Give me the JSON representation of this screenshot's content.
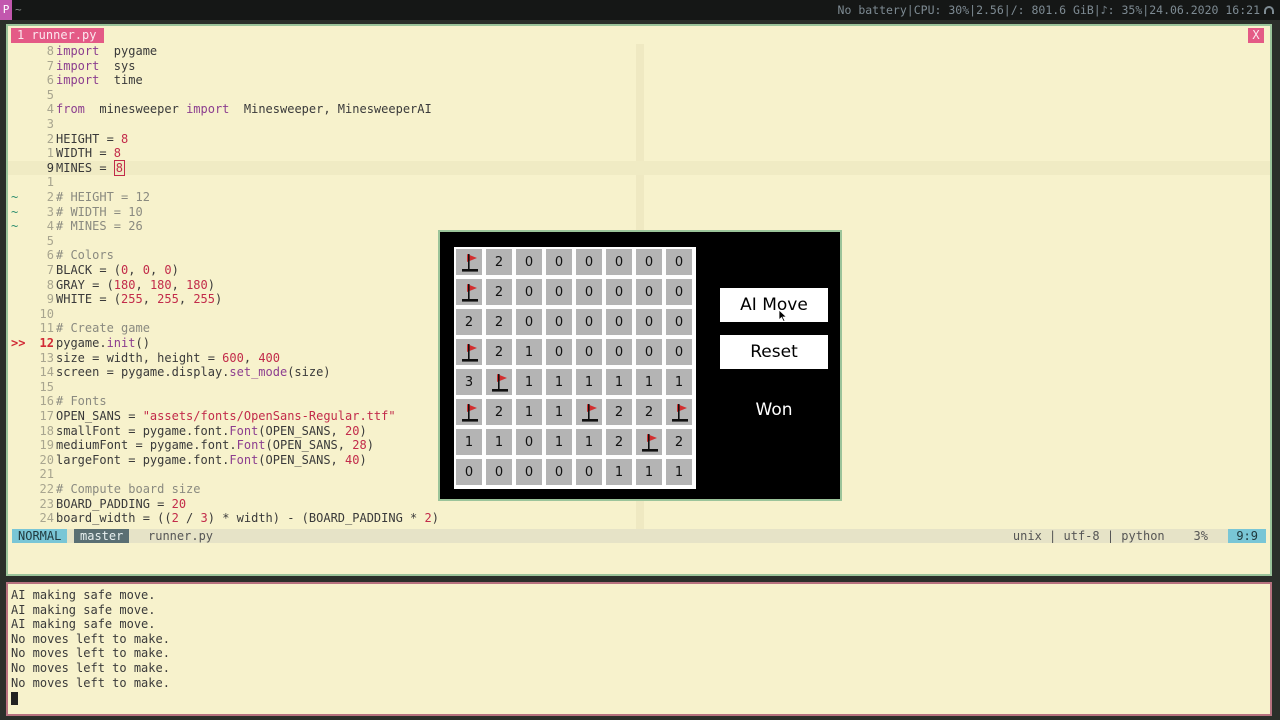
{
  "topbar": {
    "workspace": "P",
    "workspace2": "~",
    "battery": "No battery",
    "cpu": "CPU: 30%",
    "load": "2.56",
    "disk": "/: 801.6 GiB",
    "volume": "♪: 35%",
    "datetime": "24.06.2020 16:21"
  },
  "editor": {
    "tab_label": "1  runner.py",
    "tab_close": "X",
    "lines": [
      {
        "sign": "",
        "num": "8",
        "segs": [
          [
            "kw",
            "import"
          ],
          [
            "",
            "  pygame"
          ]
        ]
      },
      {
        "sign": "",
        "num": "7",
        "segs": [
          [
            "kw",
            "import"
          ],
          [
            "",
            "  sys"
          ]
        ]
      },
      {
        "sign": "",
        "num": "6",
        "segs": [
          [
            "kw",
            "import"
          ],
          [
            "",
            "  time"
          ]
        ]
      },
      {
        "sign": "",
        "num": "5",
        "segs": []
      },
      {
        "sign": "",
        "num": "4",
        "segs": [
          [
            "kw",
            "from"
          ],
          [
            "",
            "  minesweeper "
          ],
          [
            "kw",
            "import"
          ],
          [
            "",
            "  Minesweeper, MinesweeperAI"
          ]
        ]
      },
      {
        "sign": "",
        "num": "3",
        "segs": []
      },
      {
        "sign": "",
        "num": "2",
        "segs": [
          [
            "",
            "HEIGHT = "
          ],
          [
            "numl",
            "8"
          ]
        ]
      },
      {
        "sign": "",
        "num": "1",
        "segs": [
          [
            "",
            "WIDTH = "
          ],
          [
            "numl",
            "8"
          ]
        ]
      },
      {
        "sign": "",
        "num": "9",
        "cur": true,
        "segs": [
          [
            "",
            "MINES = "
          ],
          [
            "cursor",
            "8"
          ]
        ]
      },
      {
        "sign": "",
        "num": "1",
        "segs": []
      },
      {
        "sign": "~",
        "num": "2",
        "segs": [
          [
            "cmt",
            "# HEIGHT = 12"
          ]
        ]
      },
      {
        "sign": "~",
        "num": "3",
        "segs": [
          [
            "cmt",
            "# WIDTH = 10"
          ]
        ]
      },
      {
        "sign": "~",
        "num": "4",
        "segs": [
          [
            "cmt",
            "# MINES = 26"
          ]
        ]
      },
      {
        "sign": "",
        "num": "5",
        "segs": []
      },
      {
        "sign": "",
        "num": "6",
        "segs": [
          [
            "cmt",
            "# Colors"
          ]
        ]
      },
      {
        "sign": "",
        "num": "7",
        "segs": [
          [
            "",
            "BLACK = ("
          ],
          [
            "numl",
            "0"
          ],
          [
            "",
            ", "
          ],
          [
            "numl",
            "0"
          ],
          [
            "",
            ", "
          ],
          [
            "numl",
            "0"
          ],
          [
            "",
            ")"
          ]
        ]
      },
      {
        "sign": "",
        "num": "8",
        "segs": [
          [
            "",
            "GRAY = ("
          ],
          [
            "numl",
            "180"
          ],
          [
            "",
            ", "
          ],
          [
            "numl",
            "180"
          ],
          [
            "",
            ", "
          ],
          [
            "numl",
            "180"
          ],
          [
            "",
            ")"
          ]
        ]
      },
      {
        "sign": "",
        "num": "9",
        "segs": [
          [
            "",
            "WHITE = ("
          ],
          [
            "numl",
            "255"
          ],
          [
            "",
            ", "
          ],
          [
            "numl",
            "255"
          ],
          [
            "",
            ", "
          ],
          [
            "numl",
            "255"
          ],
          [
            "",
            ")"
          ]
        ]
      },
      {
        "sign": "",
        "num": "10",
        "segs": []
      },
      {
        "sign": "",
        "num": "11",
        "segs": [
          [
            "cmt",
            "# Create game"
          ]
        ]
      },
      {
        "sign": ">>",
        "num": "12",
        "bp": true,
        "segs": [
          [
            "",
            "pygame."
          ],
          [
            "kw",
            "init"
          ],
          [
            "",
            "()"
          ]
        ]
      },
      {
        "sign": "",
        "num": "13",
        "segs": [
          [
            "",
            "size = width, height = "
          ],
          [
            "numl",
            "600"
          ],
          [
            "",
            ", "
          ],
          [
            "numl",
            "400"
          ]
        ]
      },
      {
        "sign": "",
        "num": "14",
        "segs": [
          [
            "",
            "screen = pygame.display."
          ],
          [
            "kw",
            "set_mode"
          ],
          [
            "",
            "(size)"
          ]
        ]
      },
      {
        "sign": "",
        "num": "15",
        "segs": []
      },
      {
        "sign": "",
        "num": "16",
        "segs": [
          [
            "cmt",
            "# Fonts"
          ]
        ]
      },
      {
        "sign": "",
        "num": "17",
        "segs": [
          [
            "",
            "OPEN_SANS = "
          ],
          [
            "str",
            "\"assets/fonts/OpenSans-Regular.ttf\""
          ]
        ]
      },
      {
        "sign": "",
        "num": "18",
        "segs": [
          [
            "",
            "smallFont = pygame.font."
          ],
          [
            "kw",
            "Font"
          ],
          [
            "",
            "(OPEN_SANS, "
          ],
          [
            "numl",
            "20"
          ],
          [
            "",
            ")"
          ]
        ]
      },
      {
        "sign": "",
        "num": "19",
        "segs": [
          [
            "",
            "mediumFont = pygame.font."
          ],
          [
            "kw",
            "Font"
          ],
          [
            "",
            "(OPEN_SANS, "
          ],
          [
            "numl",
            "28"
          ],
          [
            "",
            ")"
          ]
        ]
      },
      {
        "sign": "",
        "num": "20",
        "segs": [
          [
            "",
            "largeFont = pygame.font."
          ],
          [
            "kw",
            "Font"
          ],
          [
            "",
            "(OPEN_SANS, "
          ],
          [
            "numl",
            "40"
          ],
          [
            "",
            ")"
          ]
        ]
      },
      {
        "sign": "",
        "num": "21",
        "segs": []
      },
      {
        "sign": "",
        "num": "22",
        "segs": [
          [
            "cmt",
            "# Compute board size"
          ]
        ]
      },
      {
        "sign": "",
        "num": "23",
        "segs": [
          [
            "",
            "BOARD_PADDING = "
          ],
          [
            "numl",
            "20"
          ]
        ]
      },
      {
        "sign": "",
        "num": "24",
        "segs": [
          [
            "",
            "board_width = (("
          ],
          [
            "numl",
            "2"
          ],
          [
            "",
            " / "
          ],
          [
            "numl",
            "3"
          ],
          [
            "",
            ") * width) - (BOARD_PADDING * "
          ],
          [
            "numl",
            "2"
          ],
          [
            "",
            ")"
          ]
        ]
      }
    ],
    "statusline": {
      "mode": "NORMAL",
      "branch": "master",
      "filename": "runner.py",
      "right": "unix | utf-8 | python    3%",
      "position": "9:9"
    }
  },
  "output": {
    "lines": [
      "AI making safe move.",
      "AI making safe move.",
      "AI making safe move.",
      "No moves left to make.",
      "No moves left to make.",
      "No moves left to make.",
      "No moves left to make."
    ]
  },
  "game": {
    "board": [
      [
        "F",
        "2",
        "0",
        "0",
        "0",
        "0",
        "0",
        "0"
      ],
      [
        "F",
        "2",
        "0",
        "0",
        "0",
        "0",
        "0",
        "0"
      ],
      [
        "2",
        "2",
        "0",
        "0",
        "0",
        "0",
        "0",
        "0"
      ],
      [
        "F",
        "2",
        "1",
        "0",
        "0",
        "0",
        "0",
        "0"
      ],
      [
        "3",
        "F",
        "1",
        "1",
        "1",
        "1",
        "1",
        "1"
      ],
      [
        "F",
        "2",
        "1",
        "1",
        "F",
        "2",
        "2",
        "F"
      ],
      [
        "1",
        "1",
        "0",
        "1",
        "1",
        "2",
        "F",
        "2"
      ],
      [
        "0",
        "0",
        "0",
        "0",
        "0",
        "1",
        "1",
        "1"
      ]
    ],
    "ai_move_label": "AI Move",
    "reset_label": "Reset",
    "status": "Won",
    "colors": {
      "cell": "#b4b4b4",
      "flag": "#d32f2f",
      "background": "#000000"
    }
  }
}
